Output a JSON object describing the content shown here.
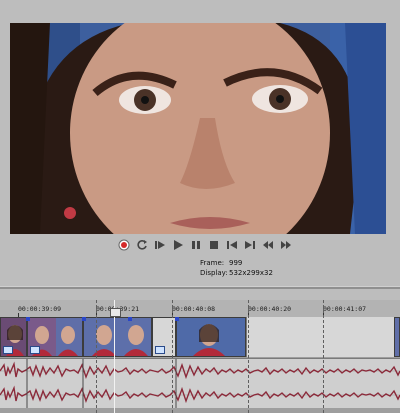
{
  "preview": {
    "frame_label": "Frame:",
    "frame_value": "999",
    "display_label": "Display:",
    "display_value": "532x299x32"
  },
  "transport": {
    "buttons": [
      "record-icon",
      "loop-icon",
      "play-from-start-icon",
      "play-icon",
      "pause-icon",
      "stop-icon",
      "prev-frame-icon",
      "next-frame-icon",
      "go-start-icon",
      "go-end-icon"
    ]
  },
  "timeline": {
    "timecodes": [
      "00:00:39:09",
      "00:00:39:21",
      "00:00:40:08",
      "00:00:40:20",
      "00:00:41:07"
    ]
  },
  "colors": {
    "record": "#d42a2a",
    "waveform": "#8b2a3a",
    "marker": "#2a46c9"
  }
}
